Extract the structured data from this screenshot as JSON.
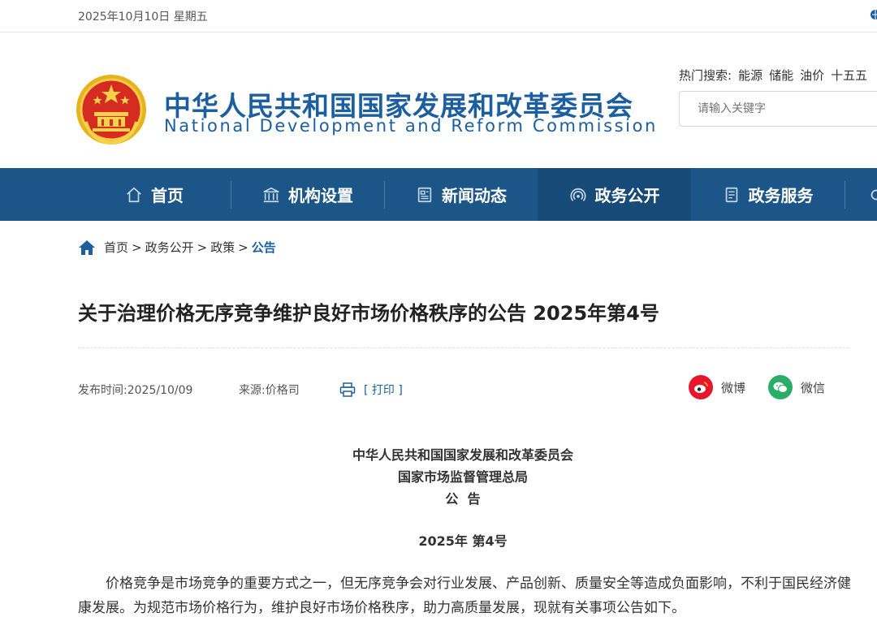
{
  "topbar": {
    "date": "2025年10月10日 星期五"
  },
  "header": {
    "title_cn": "中华人民共和国国家发展和改革委员会",
    "title_en": "National Development and Reform Commission",
    "hot_label": "热门搜索:",
    "hot_keywords": [
      "能源",
      "储能",
      "油价",
      "十五五"
    ],
    "search_placeholder": "请输入关键字"
  },
  "nav": {
    "items": [
      {
        "label": "首页",
        "icon": "home-icon"
      },
      {
        "label": "机构设置",
        "icon": "institution-icon"
      },
      {
        "label": "新闻动态",
        "icon": "news-icon"
      },
      {
        "label": "政务公开",
        "icon": "broadcast-icon"
      },
      {
        "label": "政务服务",
        "icon": "document-icon"
      }
    ],
    "active_index": 3
  },
  "breadcrumb": {
    "items": [
      "首页",
      "政务公开",
      "政策"
    ],
    "current": "公告",
    "separator": ">"
  },
  "article": {
    "title": "关于治理价格无序竞争维护良好市场价格秩序的公告 2025年第4号",
    "publish_label": "发布时间:",
    "publish_date": "2025/10/09",
    "source_label": "来源:",
    "source": "价格司",
    "print_label": "[ 打印 ]",
    "share": {
      "weibo": "微博",
      "wechat": "微信"
    },
    "issuer_1": "中华人民共和国国家发展和改革委员会",
    "issuer_2": "国家市场监督管理总局",
    "doc_type": "公  告",
    "doc_number": "2025年 第4号",
    "paragraph_1": "价格竞争是市场竞争的重要方式之一，但无序竞争会对行业发展、产品创新、质量安全等造成负面影响，不利于国民经济健康发展。为规范市场价格行为，维护良好市场价格秩序，助力高质量发展，现就有关事项公告如下。"
  },
  "colors": {
    "brand_blue": "#1b5fa1",
    "nav_bg": "#1c5689",
    "nav_active": "#174a77",
    "weibo_red": "#e6162d",
    "wechat_green": "#2aae67"
  }
}
